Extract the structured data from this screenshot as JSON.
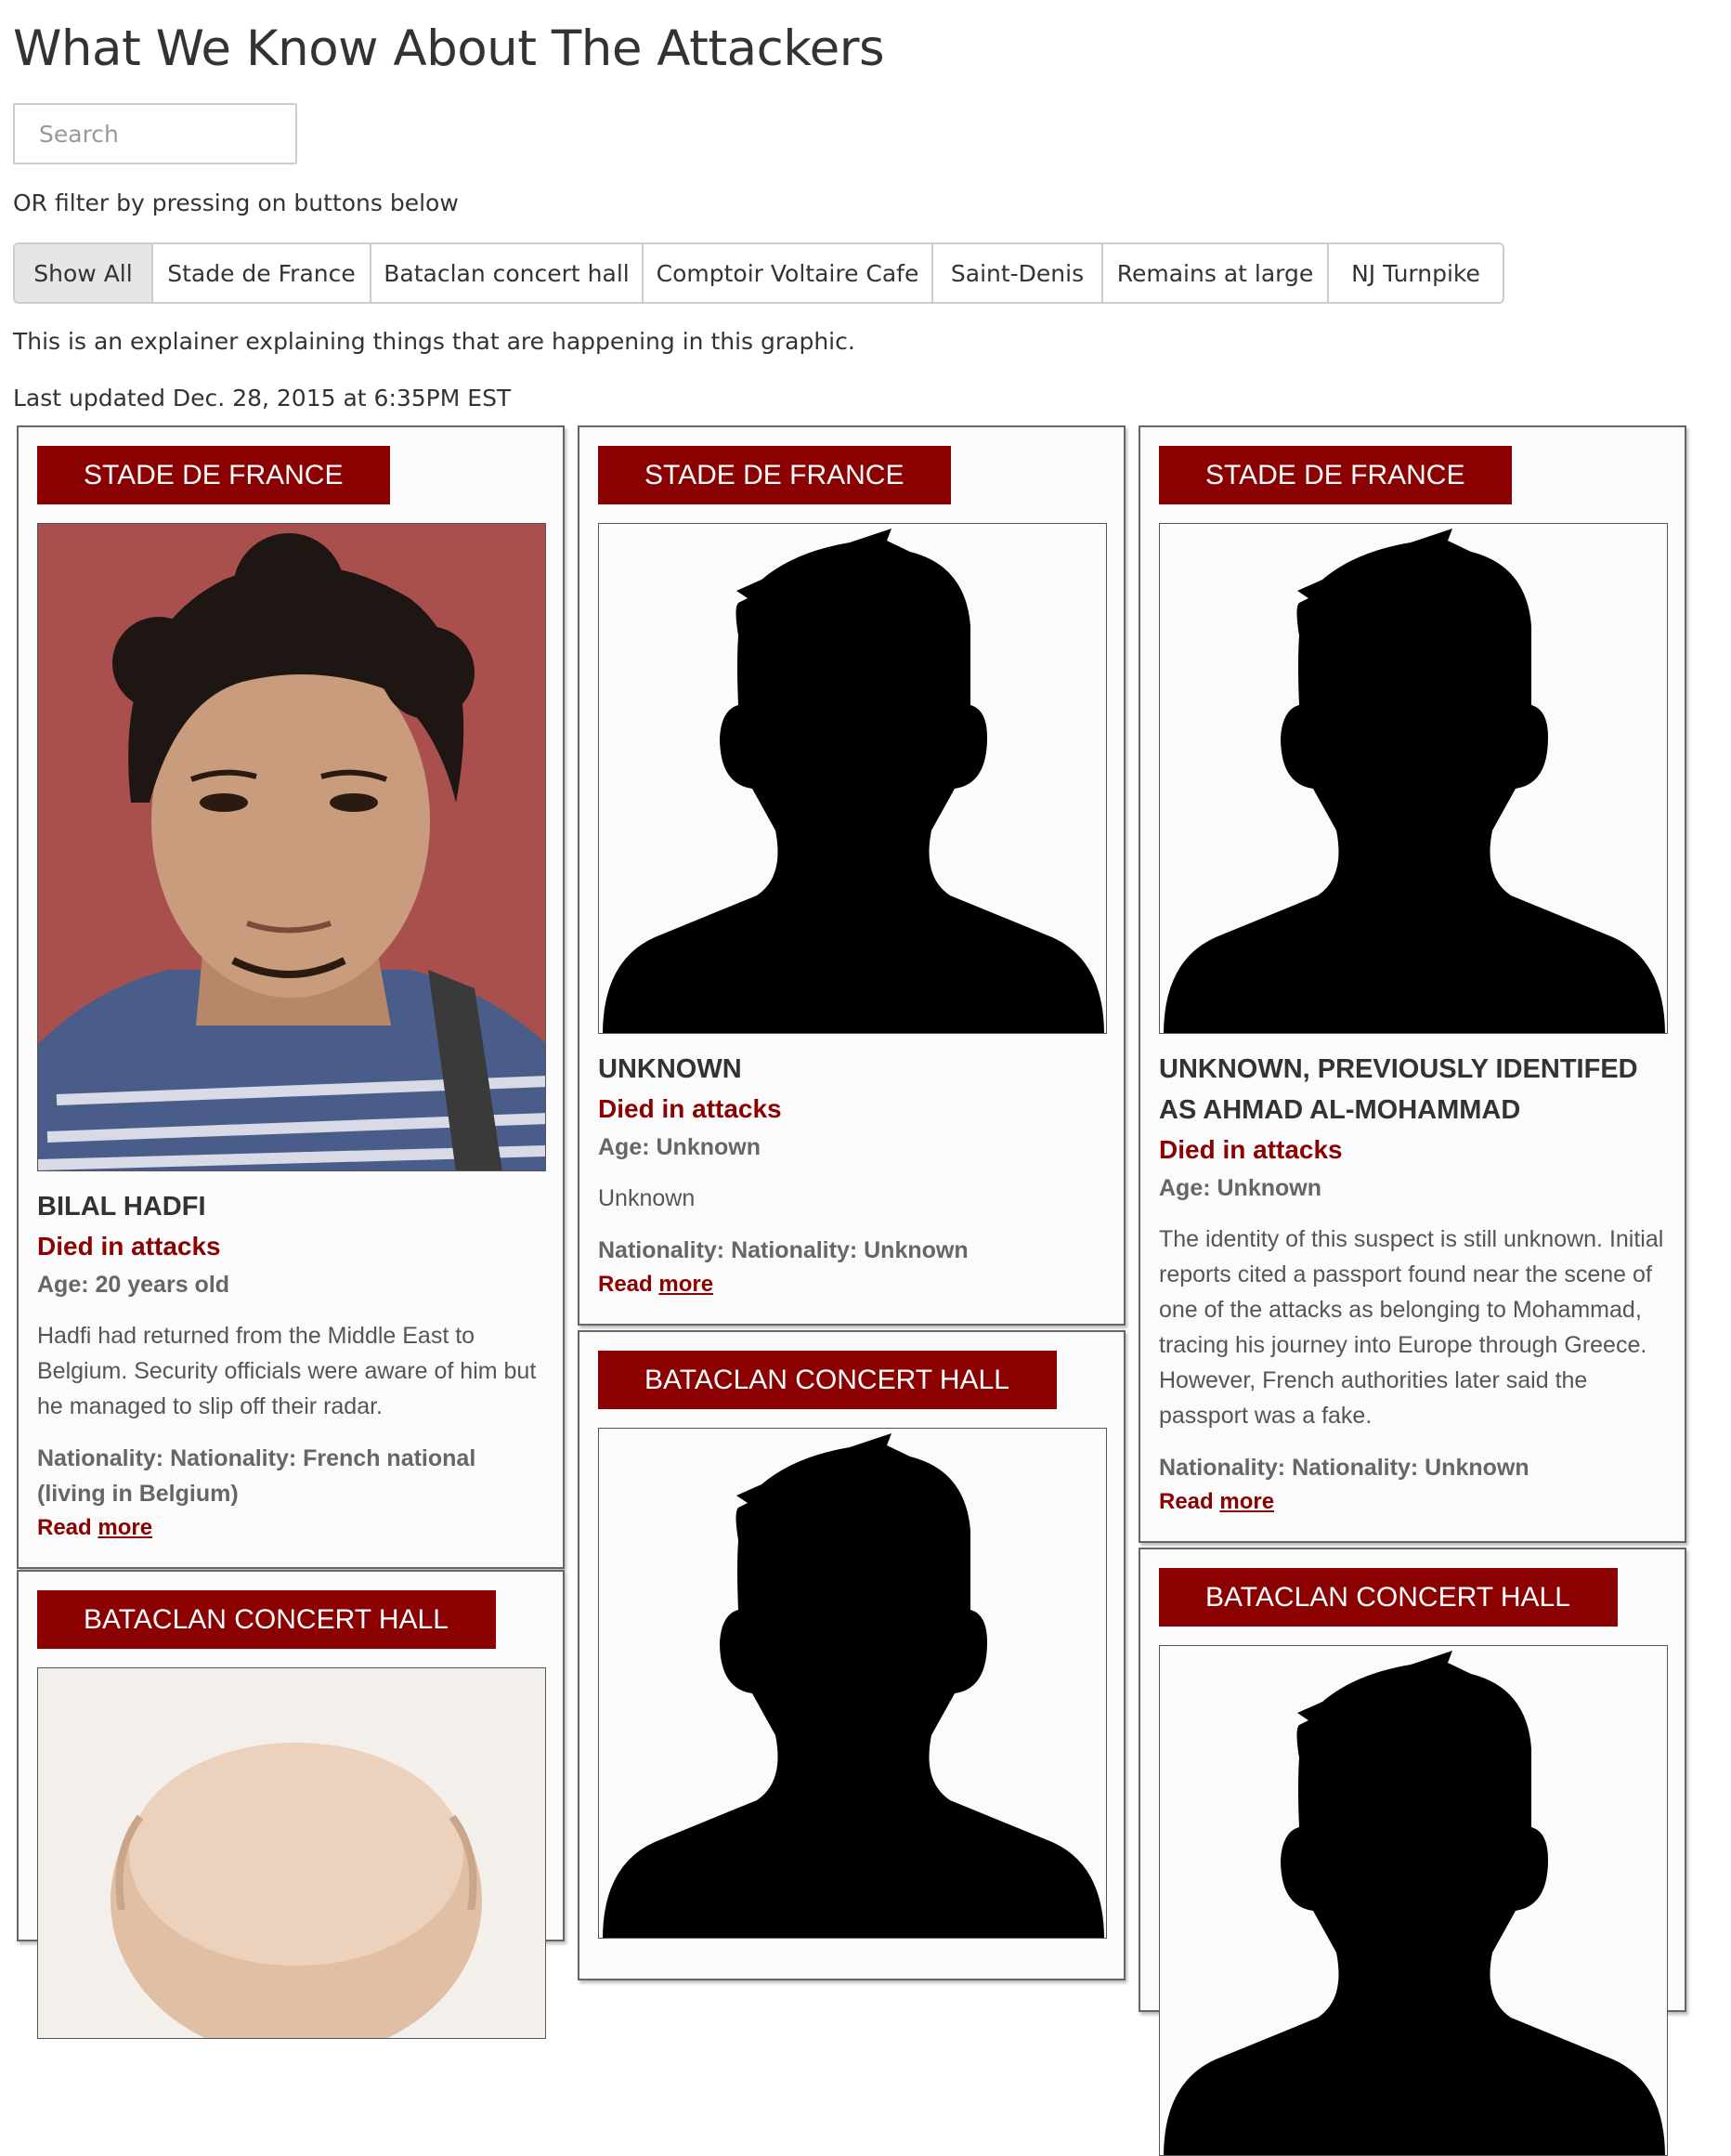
{
  "page": {
    "title": "What We Know About The Attackers",
    "search_placeholder": "Search",
    "filter_hint": "OR filter by pressing on buttons below",
    "explainer": "This is an explainer explaining things that are happening in this graphic.",
    "last_updated": "Last updated Dec. 28, 2015 at 6:35PM EST"
  },
  "filters": [
    {
      "label": "Show All",
      "active": true
    },
    {
      "label": "Stade de France",
      "active": false
    },
    {
      "label": "Bataclan concert hall",
      "active": false
    },
    {
      "label": "Comptoir Voltaire Cafe",
      "active": false
    },
    {
      "label": "Saint-Denis",
      "active": false
    },
    {
      "label": "Remains at large",
      "active": false
    },
    {
      "label": "NJ Turnpike",
      "active": false
    }
  ],
  "cards": [
    {
      "location": "STADE DE FRANCE",
      "photo": "portrait-photo",
      "name": "BILAL HADFI",
      "status": "Died in attacks",
      "age": "Age: 20 years old",
      "description": "Hadfi had returned from the Middle East to Belgium. Security officials were aware of him but he managed to slip off their radar.",
      "nationality": "Nationality: Nationality: French national (living in Belgium)",
      "read_label": "Read",
      "more_label": "more"
    },
    {
      "location": "STADE DE FRANCE",
      "photo": "silhouette-icon",
      "name": "UNKNOWN",
      "status": "Died in attacks",
      "age": "Age: Unknown",
      "description": "Unknown",
      "nationality": "Nationality: Nationality: Unknown",
      "read_label": "Read",
      "more_label": "more"
    },
    {
      "location": "STADE DE FRANCE",
      "photo": "silhouette-icon",
      "name": "UNKNOWN, PREVIOUSLY IDENTIFED AS AHMAD AL-MOHAMMAD",
      "status": "Died in attacks",
      "age": "Age: Unknown",
      "description": "The identity of this suspect is still unknown. Initial reports cited a passport found near the scene of one of the attacks as belonging to Mohammad, tracing his journey into Europe through Greece. However, French authorities later said the passport was a fake.",
      "nationality": "Nationality: Nationality: Unknown",
      "read_label": "Read",
      "more_label": "more"
    },
    {
      "location": "BATACLAN CONCERT HALL",
      "photo": "portrait-photo"
    },
    {
      "location": "BATACLAN CONCERT HALL",
      "photo": "silhouette-icon"
    },
    {
      "location": "BATACLAN CONCERT HALL",
      "photo": "silhouette-icon"
    }
  ],
  "colors": {
    "accent": "#8b0000",
    "card_border": "#666666",
    "button_active": "#e6e6e6"
  }
}
